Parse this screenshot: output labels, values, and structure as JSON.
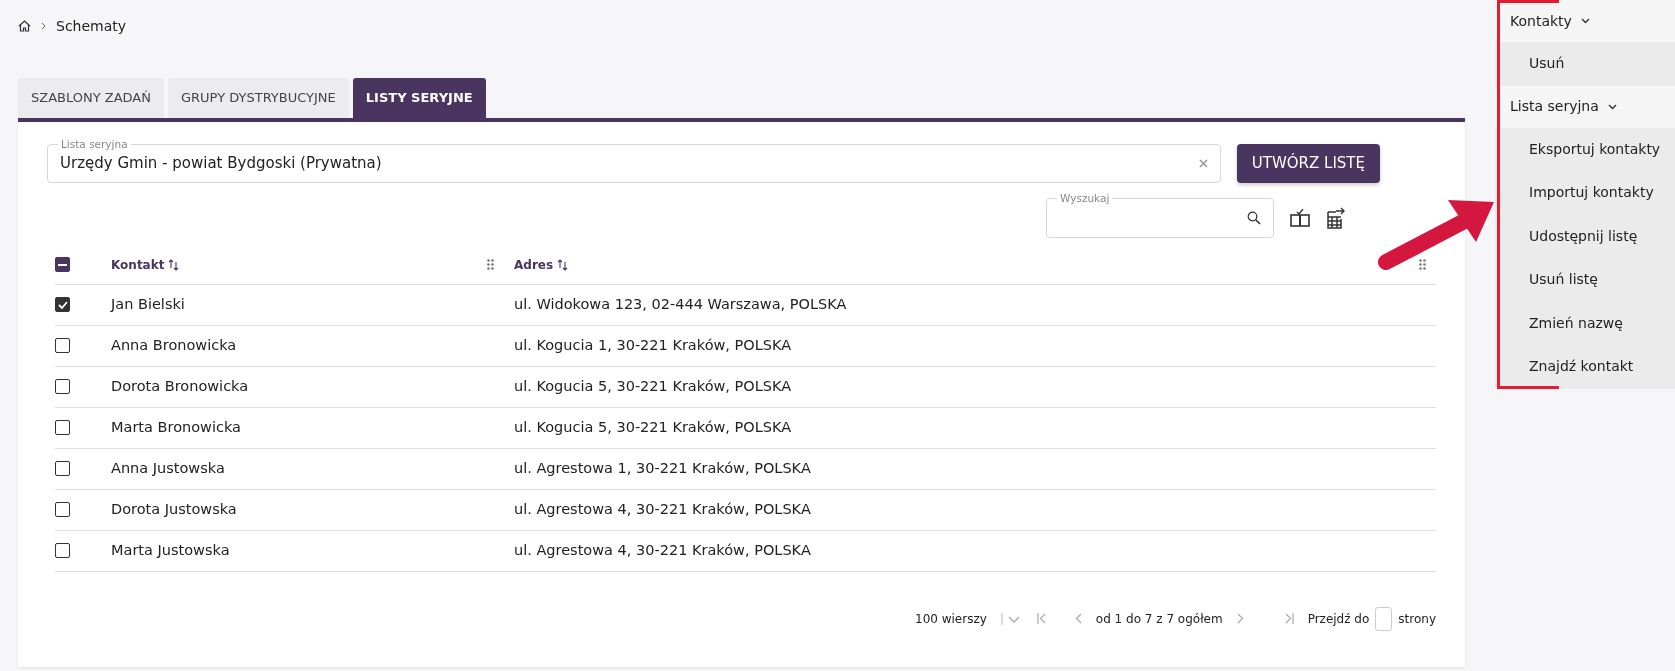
{
  "breadcrumb": {
    "current": "Schematy"
  },
  "tabs": [
    {
      "label": "SZABLONY ZADAŃ",
      "selected": false
    },
    {
      "label": "GRUPY DYSTRYBUCYJNE",
      "selected": false
    },
    {
      "label": "LISTY SERYJNE",
      "selected": true
    }
  ],
  "list_field": {
    "label": "Lista seryjna",
    "value": "Urzędy Gmin - powiat Bydgoski (Prywatna)"
  },
  "create_button": "UTWÓRZ LISTĘ",
  "search": {
    "label": "Wyszukaj"
  },
  "table": {
    "select_all": {
      "indeterminate": true
    },
    "columns": [
      {
        "label": "Kontakt"
      },
      {
        "label": "Adres"
      }
    ],
    "rows": [
      {
        "selected": true,
        "contact": "Jan Bielski",
        "address": "ul. Widokowa 123, 02-444 Warszawa, POLSKA"
      },
      {
        "selected": false,
        "contact": "Anna Bronowicka",
        "address": "ul. Kogucia 1, 30-221 Kraków, POLSKA"
      },
      {
        "selected": false,
        "contact": "Dorota Bronowicka",
        "address": "ul. Kogucia 5, 30-221 Kraków, POLSKA"
      },
      {
        "selected": false,
        "contact": "Marta Bronowicka",
        "address": "ul. Kogucia 5, 30-221 Kraków, POLSKA"
      },
      {
        "selected": false,
        "contact": "Anna Justowska",
        "address": "ul. Agrestowa 1, 30-221 Kraków, POLSKA"
      },
      {
        "selected": false,
        "contact": "Dorota Justowska",
        "address": "ul. Agrestowa 4, 30-221 Kraków, POLSKA"
      },
      {
        "selected": false,
        "contact": "Marta Justowska",
        "address": "ul. Agrestowa 4, 30-221 Kraków, POLSKA"
      }
    ]
  },
  "pagination": {
    "page_size": "100 wierszy",
    "range": "od 1 do 7 z 7 ogółem",
    "goto_label": "Przejdź do",
    "goto_suffix": "strony"
  },
  "side_menu": [
    {
      "title": "Kontakty",
      "expanded": true,
      "items": [
        "Usuń"
      ]
    },
    {
      "title": "Lista seryjna",
      "expanded": true,
      "items": [
        "Eksportuj kontakty",
        "Importuj kontakty",
        "Udostępnij listę",
        "Usuń listę",
        "Zmień nazwę",
        "Znajdź kontakt"
      ]
    }
  ]
}
